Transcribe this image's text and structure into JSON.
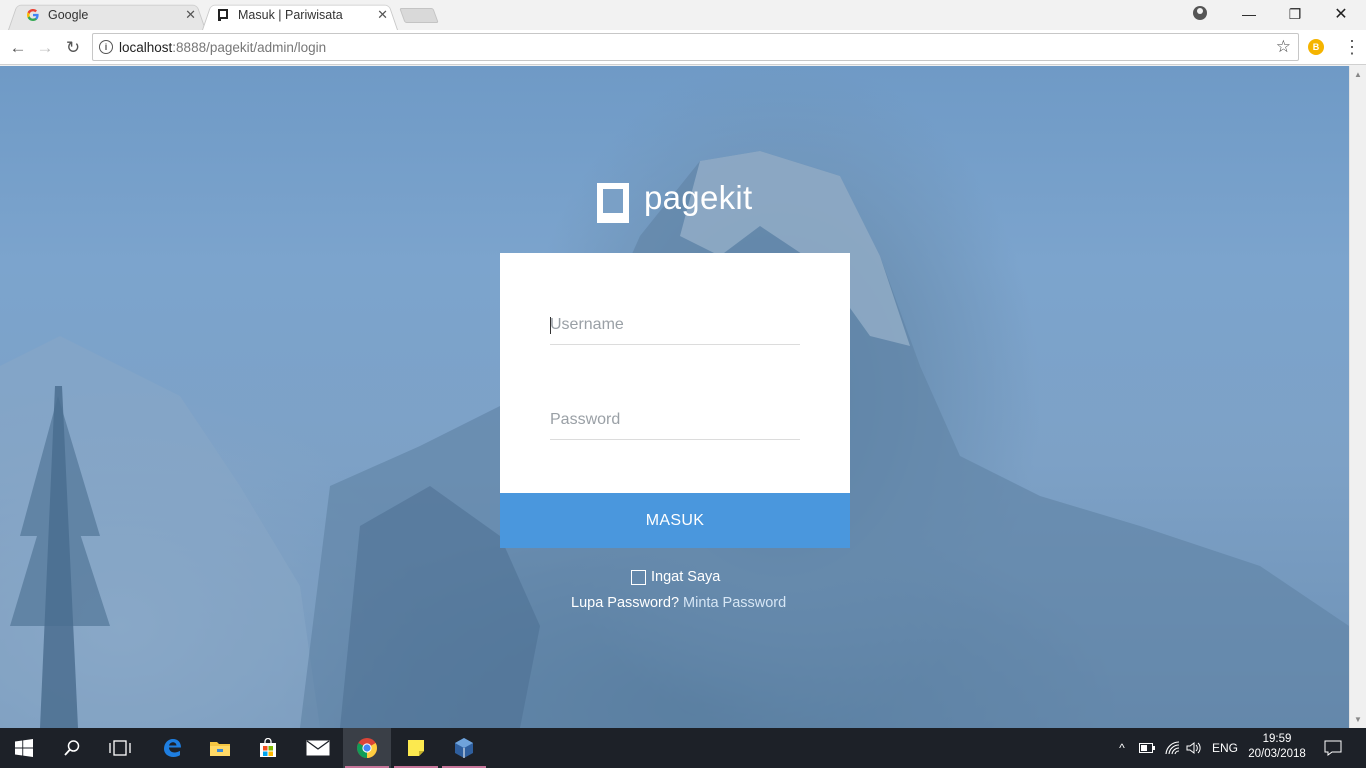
{
  "browser": {
    "tabs": [
      {
        "title": "Google",
        "favicon": "google-g-icon",
        "active": false
      },
      {
        "title": "Masuk | Pariwisata",
        "favicon": "pagekit-icon",
        "active": true
      }
    ],
    "url_host": "localhost",
    "url_rest": ":8888/pagekit/admin/login",
    "extension_badge": "B"
  },
  "login": {
    "brand": "pagekit",
    "username_placeholder": "Username",
    "password_placeholder": "Password",
    "submit_label": "MASUK",
    "remember_label": "Ingat Saya",
    "forgot_prefix": "Lupa Password?",
    "forgot_link": "Minta Password",
    "button_color": "#4a97dd"
  },
  "taskbar": {
    "apps": [
      "windows-start-icon",
      "search-icon",
      "task-view-icon",
      "edge-icon",
      "file-explorer-icon",
      "store-icon",
      "mail-icon",
      "chrome-icon",
      "sticky-notes-icon",
      "virtualbox-icon"
    ],
    "language": "ENG",
    "time": "19:59",
    "date": "20/03/2018"
  }
}
